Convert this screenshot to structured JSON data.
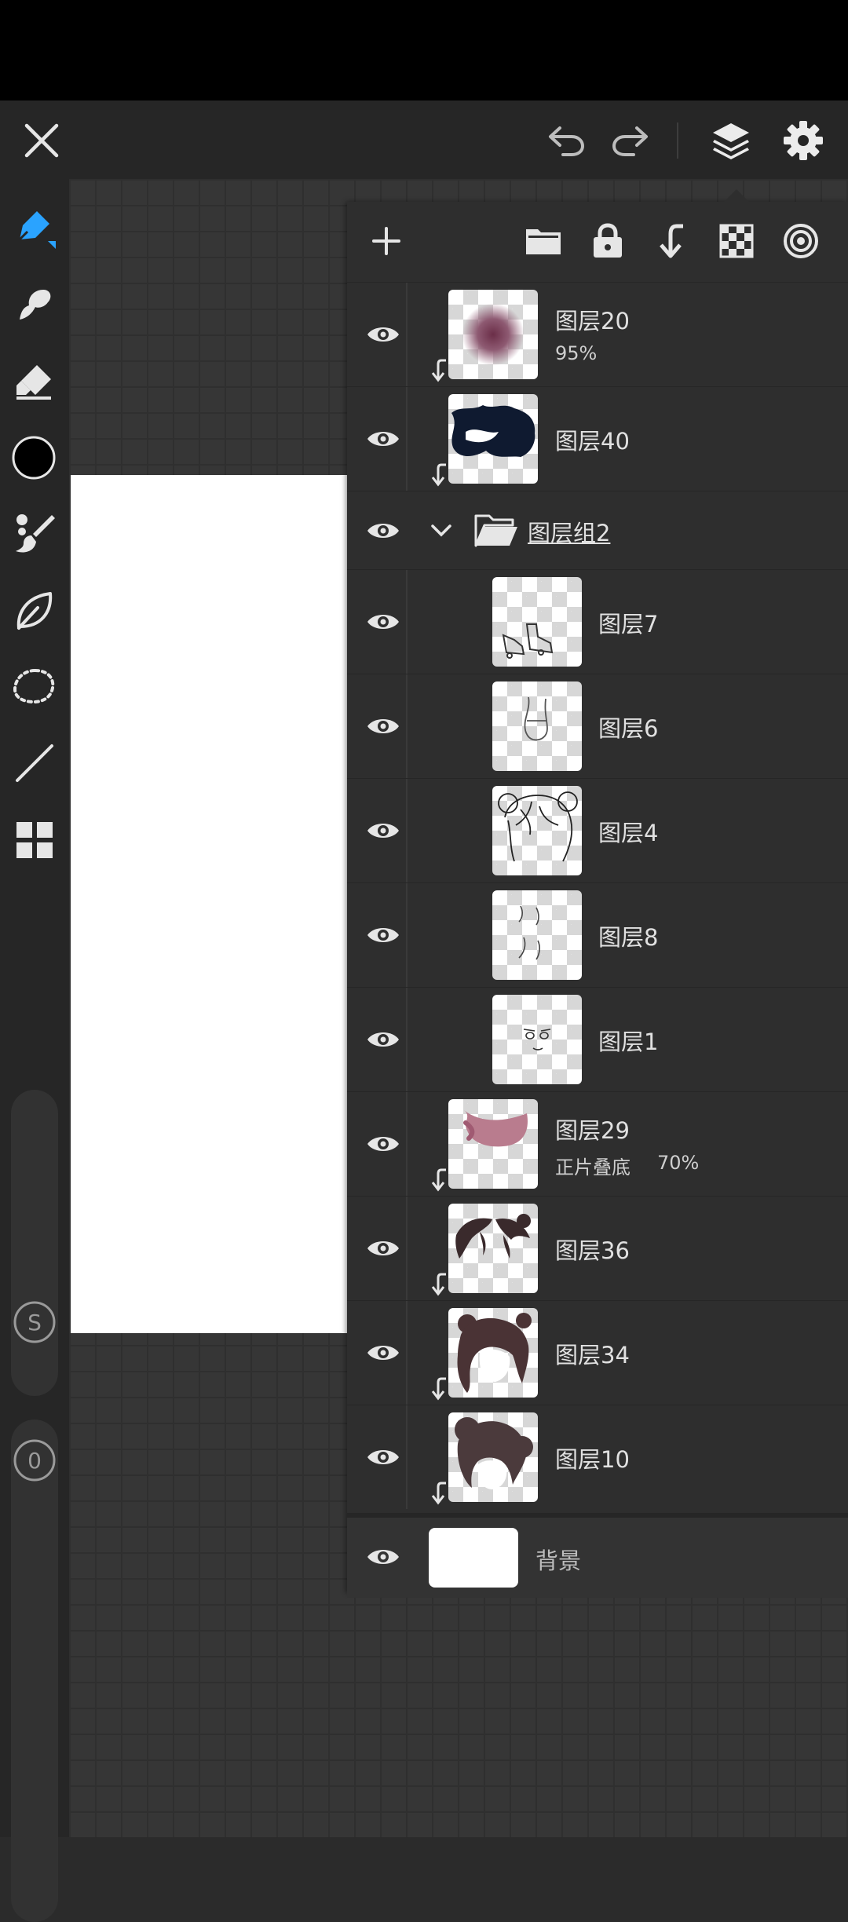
{
  "top_bar": {
    "close_icon": "close-icon",
    "undo_icon": "undo-icon",
    "redo_icon": "redo-icon",
    "layers_icon": "layers-icon",
    "settings_icon": "gear-icon"
  },
  "colors": {
    "accent": "#2aa3ff",
    "current_color": "#000000",
    "panel_bg": "#2e2e2e",
    "toolbar_bg": "#262626"
  },
  "tools": [
    "pen-icon",
    "smudge-icon",
    "eraser-icon",
    "color-swatch",
    "brush-icon",
    "leaf-icon",
    "lasso-icon",
    "line-icon",
    "grid-icon"
  ],
  "side_controls": {
    "size_label": "S",
    "opacity_label": "0"
  },
  "layer_toolbar": [
    "add-layer-icon",
    "folder-icon",
    "lock-icon",
    "clip-icon",
    "transparency-icon",
    "blend-target-icon"
  ],
  "layers": [
    {
      "name": "图层20",
      "sub": "95%"
    },
    {
      "name": "图层40",
      "sub": ""
    },
    {
      "name": "图层组2",
      "sub": ""
    },
    {
      "name": "图层7",
      "sub": ""
    },
    {
      "name": "图层6",
      "sub": ""
    },
    {
      "name": "图层4",
      "sub": ""
    },
    {
      "name": "图层8",
      "sub": ""
    },
    {
      "name": "图层1",
      "sub": ""
    },
    {
      "name": "图层29",
      "sub": "正片叠底",
      "opacity": "70%"
    },
    {
      "name": "图层36",
      "sub": ""
    },
    {
      "name": "图层34",
      "sub": ""
    },
    {
      "name": "图层10",
      "sub": ""
    },
    {
      "name": "背景",
      "sub": ""
    }
  ]
}
